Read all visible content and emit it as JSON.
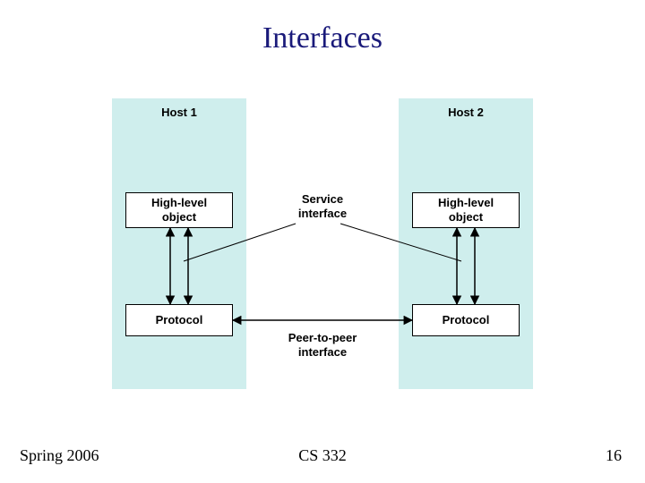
{
  "title": "Interfaces",
  "footer": {
    "left": "Spring 2006",
    "center": "CS 332",
    "right": "16"
  },
  "hosts": {
    "host1": "Host 1",
    "host2": "Host 2"
  },
  "boxes": {
    "high1": "High-level\nobject",
    "high2": "High-level\nobject",
    "proto1": "Protocol",
    "proto2": "Protocol"
  },
  "annotations": {
    "service": "Service\ninterface",
    "peer": "Peer-to-peer\ninterface"
  }
}
